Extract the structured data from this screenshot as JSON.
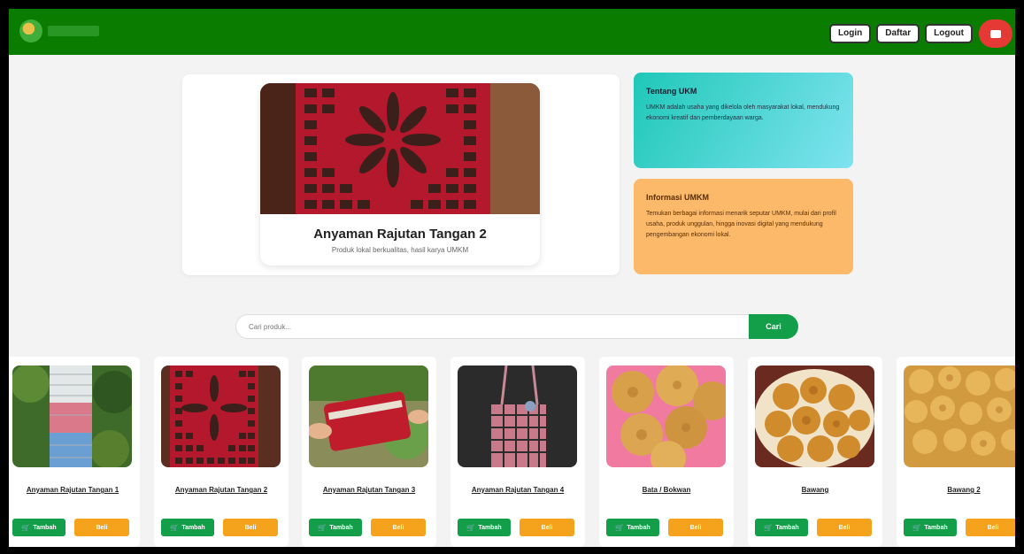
{
  "navbar": {
    "logo_alt": "logo",
    "buttons": [
      "Login",
      "Daftar",
      "Logout"
    ],
    "chat_icon": "chat-icon",
    "color": "#0a7d00"
  },
  "hero": {
    "title": "Anyaman Rajutan Tangan 2",
    "subtitle": "Produk lokal berkualitas, hasil karya UMKM"
  },
  "info": [
    {
      "title": "Tentang UKM",
      "text": "UMKM adalah usaha yang dikelola oleh masyarakat lokal, mendukung ekonomi kreatif dan pemberdayaan warga."
    },
    {
      "title": "Informasi UMKM",
      "text": "Temukan berbagai informasi menarik seputar UMKM, mulai dari profil usaha, produk unggulan, hingga inovasi digital yang mendukung pengembangan ekonomi lokal."
    }
  ],
  "search": {
    "placeholder": "Cari produk...",
    "button": "Cari"
  },
  "products": [
    {
      "name": "Anyaman Rajutan Tangan 1"
    },
    {
      "name": "Anyaman Rajutan Tangan 2"
    },
    {
      "name": "Anyaman Rajutan Tangan 3"
    },
    {
      "name": "Anyaman Rajutan Tangan 4"
    },
    {
      "name": "Bata / Bokwan"
    },
    {
      "name": "Bawang"
    },
    {
      "name": "Bawang 2"
    }
  ],
  "actions": {
    "add": "Tambah",
    "buy": "Beli"
  },
  "colors": {
    "green_button": "#139f4a",
    "orange_button": "#f5a21d",
    "teal_card": "#1fc8b8",
    "orange_card": "#fcb96a"
  }
}
